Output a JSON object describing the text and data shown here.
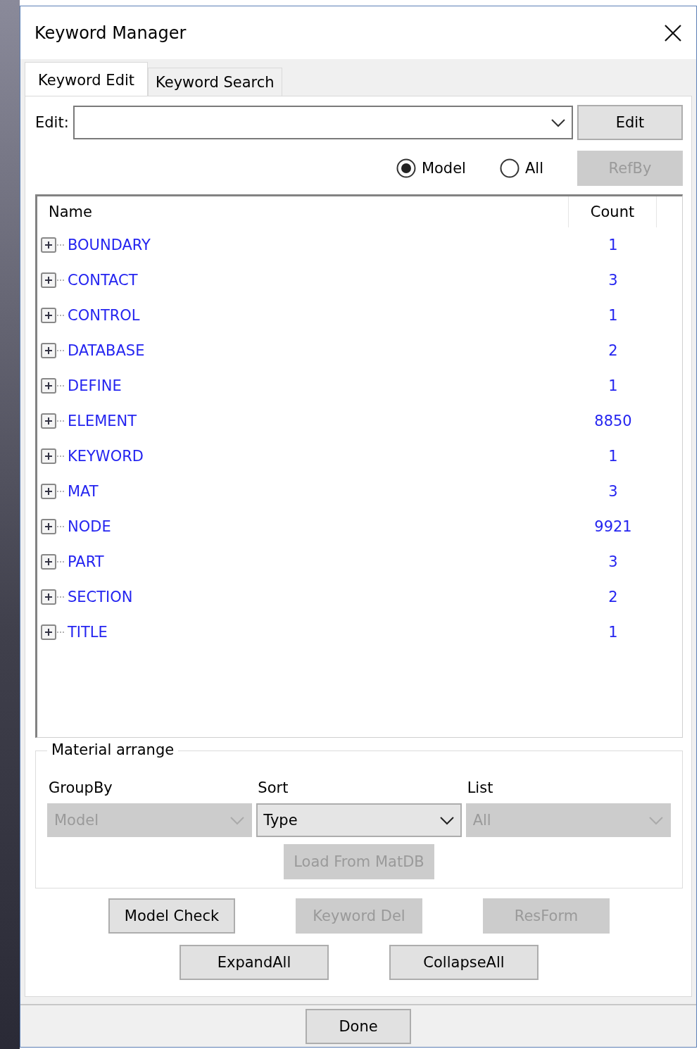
{
  "window": {
    "title": "Keyword Manager"
  },
  "tabs": [
    {
      "label": "Keyword Edit",
      "selected": true
    },
    {
      "label": "Keyword Search",
      "selected": false
    }
  ],
  "edit_row": {
    "label": "Edit:",
    "button": {
      "label": "Edit",
      "disabled": false
    }
  },
  "scope": [
    {
      "label": "Model",
      "selected": true
    },
    {
      "label": "All",
      "selected": false
    }
  ],
  "refby_button": {
    "label": "RefBy",
    "disabled": true
  },
  "tree": {
    "columns": [
      "Name",
      "Count"
    ],
    "rows": [
      {
        "name": "BOUNDARY",
        "count": "1",
        "expanded": false
      },
      {
        "name": "CONTACT",
        "count": "3",
        "expanded": false
      },
      {
        "name": "CONTROL",
        "count": "1",
        "expanded": false
      },
      {
        "name": "DATABASE",
        "count": "2",
        "expanded": false
      },
      {
        "name": "DEFINE",
        "count": "1",
        "expanded": false
      },
      {
        "name": "ELEMENT",
        "count": "8850",
        "expanded": false
      },
      {
        "name": "KEYWORD",
        "count": "1",
        "expanded": false
      },
      {
        "name": "MAT",
        "count": "3",
        "expanded": false
      },
      {
        "name": "NODE",
        "count": "9921",
        "expanded": false
      },
      {
        "name": "PART",
        "count": "3",
        "expanded": false
      },
      {
        "name": "SECTION",
        "count": "2",
        "expanded": false
      },
      {
        "name": "TITLE",
        "count": "1",
        "expanded": false
      }
    ]
  },
  "material_arrange": {
    "title": "Material arrange",
    "dropdowns": [
      {
        "label": "GroupBy",
        "value": "Model",
        "disabled": true
      },
      {
        "label": "Sort",
        "value": "Type",
        "disabled": false
      },
      {
        "label": "List",
        "value": "All",
        "disabled": true
      }
    ],
    "load_button": {
      "label": "Load From MatDB",
      "disabled": true
    }
  },
  "button_rows": [
    [
      {
        "label": "Model Check",
        "disabled": false
      },
      {
        "label": "Keyword Del",
        "disabled": true
      },
      {
        "label": "ResForm",
        "disabled": true
      }
    ],
    [
      {
        "label": "ExpandAll",
        "disabled": false
      },
      {
        "label": "CollapseAll",
        "disabled": false
      }
    ]
  ],
  "done_button": {
    "label": "Done",
    "disabled": false
  }
}
